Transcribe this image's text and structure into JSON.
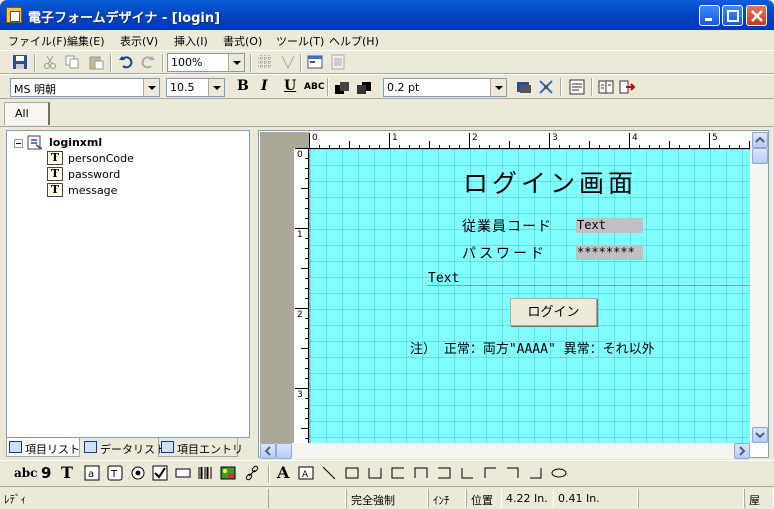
{
  "window": {
    "title": "電子フォームデザイナ - [login]"
  },
  "menu": [
    "ファイル(F)",
    "編集(E)",
    "表示(V)",
    "挿入(I)",
    "書式(O)",
    "ツール(T)",
    "ヘルプ(H)"
  ],
  "toolbar": {
    "zoom": "100%",
    "font_name": "MS 明朝",
    "font_size": "10.5",
    "line_width": "0.2 pt",
    "bold": "B",
    "italic": "I",
    "underline": "U",
    "abc": "ABC"
  },
  "tabs": {
    "all": "All"
  },
  "tree": {
    "root": "loginxml",
    "items": [
      "personCode",
      "password",
      "message"
    ]
  },
  "panel_tabs": [
    "項目リスト",
    "データリスト",
    "項目エントリ"
  ],
  "form": {
    "title": "ログイン画面",
    "employee_code_label": "従業員コード",
    "employee_code_value": "Text",
    "password_label": "パスワード",
    "password_value": "********",
    "message_text": "Text",
    "login_button": "ログイン",
    "note": "注） 正常：両方\"AAAA\" 異常：それ以外"
  },
  "ruler": {
    "h_labels": [
      "0",
      "1",
      "2",
      "3",
      "4",
      "5"
    ],
    "v_labels": [
      "0",
      "1",
      "2",
      "3"
    ]
  },
  "shape_toolbar": {
    "abc": "abc",
    "nine": "9",
    "T": "T",
    "A": "A"
  },
  "status": {
    "ready": "ﾚﾃﾞｨ",
    "mode": "完全強制",
    "unit": "ｲﾝﾁ",
    "position_label": "位置",
    "position_x": "4.22 In.",
    "position_y": "0.41 In.",
    "tail": "屋"
  },
  "colors": {
    "title_bar": "#0a5fd8",
    "form_background": "#80ffff",
    "close_button": "#c43a18"
  }
}
